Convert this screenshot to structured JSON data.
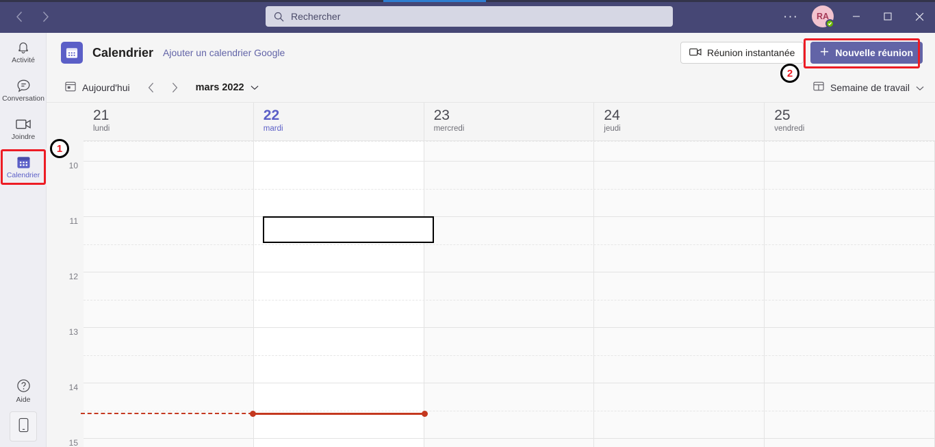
{
  "titlebar": {
    "back_icon": "chevron-left-icon",
    "forward_icon": "chevron-right-icon",
    "search": {
      "placeholder": "Rechercher",
      "value": "",
      "icon": "search-icon"
    },
    "more_label": "···",
    "avatar": {
      "initials": "RA",
      "presence": "available",
      "presence_color": "#6bb700"
    },
    "window": {
      "minimize": "—",
      "maximize": "☐",
      "close": "✕"
    }
  },
  "rail": {
    "items": [
      {
        "label": "Activité",
        "icon": "bell-icon",
        "active": false
      },
      {
        "label": "Conversation",
        "icon": "chat-icon",
        "active": false
      },
      {
        "label": "Joindre",
        "icon": "video-camera-icon",
        "active": false
      },
      {
        "label": "Calendrier",
        "icon": "calendar-icon",
        "active": true
      }
    ],
    "help": {
      "label": "Aide",
      "icon": "question-circle-icon"
    },
    "mobile": {
      "icon": "mobile-phone-icon"
    }
  },
  "app_header": {
    "icon": "calendar-app-icon",
    "title": "Calendrier",
    "link": "Ajouter un calendrier Google",
    "meet_now_label": "Réunion instantanée",
    "meet_now_icon": "video-camera-icon",
    "new_meeting_label": "Nouvelle réunion",
    "new_meeting_icon": "plus-icon"
  },
  "toolbar": {
    "today_label": "Aujourd'hui",
    "today_icon": "today-calendar-icon",
    "prev_icon": "chevron-left-icon",
    "next_icon": "chevron-right-icon",
    "period_label": "mars 2022",
    "period_chevron": "chevron-down-icon",
    "view_label": "Semaine de travail",
    "view_icon": "view-layout-icon",
    "view_chevron": "chevron-down-icon"
  },
  "calendar": {
    "days": [
      {
        "num": "21",
        "name": "lundi",
        "today": false
      },
      {
        "num": "22",
        "name": "mardi",
        "today": true
      },
      {
        "num": "23",
        "name": "mercredi",
        "today": false
      },
      {
        "num": "24",
        "name": "jeudi",
        "today": false
      },
      {
        "num": "25",
        "name": "vendredi",
        "today": false
      }
    ],
    "hours": [
      "10",
      "11",
      "12",
      "13",
      "14",
      "15"
    ],
    "selected_slot": {
      "day": "mardi",
      "start": "11:00",
      "end": "11:30"
    },
    "current_time_color": "#c4381f"
  },
  "annotations": [
    {
      "id": "1",
      "target": "sidebar-item-calendrier"
    },
    {
      "id": "2",
      "target": "new-meeting-button"
    }
  ],
  "colors": {
    "brand_purple": "#464775",
    "accent": "#6264a7",
    "annotation_red": "#ed1c24"
  }
}
